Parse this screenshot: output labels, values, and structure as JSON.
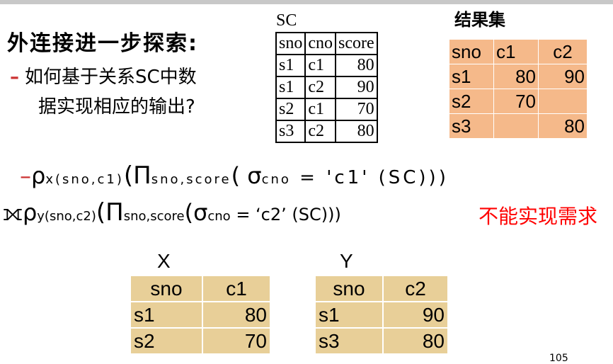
{
  "title": "外连接进一步探索:",
  "bullet": {
    "line1": "如何基于关系SC中数",
    "line2": "据实现相应的输出?"
  },
  "sc_table": {
    "label": "SC",
    "headers": [
      "sno",
      "cno",
      "score"
    ],
    "rows": [
      [
        "s1",
        "c1",
        "80"
      ],
      [
        "s1",
        "c2",
        "90"
      ],
      [
        "s2",
        "c1",
        "70"
      ],
      [
        "s3",
        "c2",
        "80"
      ]
    ]
  },
  "result_table": {
    "label": "结果集",
    "headers": [
      "sno",
      "c1",
      "c2"
    ],
    "rows": [
      [
        "s1",
        "80",
        "90"
      ],
      [
        "s2",
        "70",
        ""
      ],
      [
        "s3",
        "",
        "80"
      ]
    ]
  },
  "expr1": {
    "dash": "–",
    "rho": "ρ",
    "rho_sub": "x(sno,c1)",
    "pi_open": "(Π",
    "pi_sub": "sno,score",
    "sigma_open": "( σ",
    "sigma_sub": "cno",
    "cond": " = 'c1' (SC)))"
  },
  "expr2": {
    "join": "⟗",
    "rho": "ρ",
    "rho_sub": "y(sno,c2)",
    "pi_open": "(Π",
    "pi_sub": "sno,score",
    "sigma_open": "(σ",
    "sigma_sub": "cno",
    "cond": " =  ‘c2’  (SC)))"
  },
  "note": "不能实现需求",
  "x_table": {
    "label": "X",
    "headers": [
      "sno",
      "c1"
    ],
    "rows": [
      [
        "s1",
        "80"
      ],
      [
        "s2",
        "70"
      ]
    ]
  },
  "y_table": {
    "label": "Y",
    "headers": [
      "sno",
      "c2"
    ],
    "rows": [
      [
        "s1",
        "90"
      ],
      [
        "s3",
        "80"
      ]
    ]
  },
  "page_number": "105",
  "colors": {
    "dash": "#cc3333",
    "note": "#ff0000",
    "result_fill": "#f5b98a",
    "parchment_fill": "#e8cf98"
  }
}
